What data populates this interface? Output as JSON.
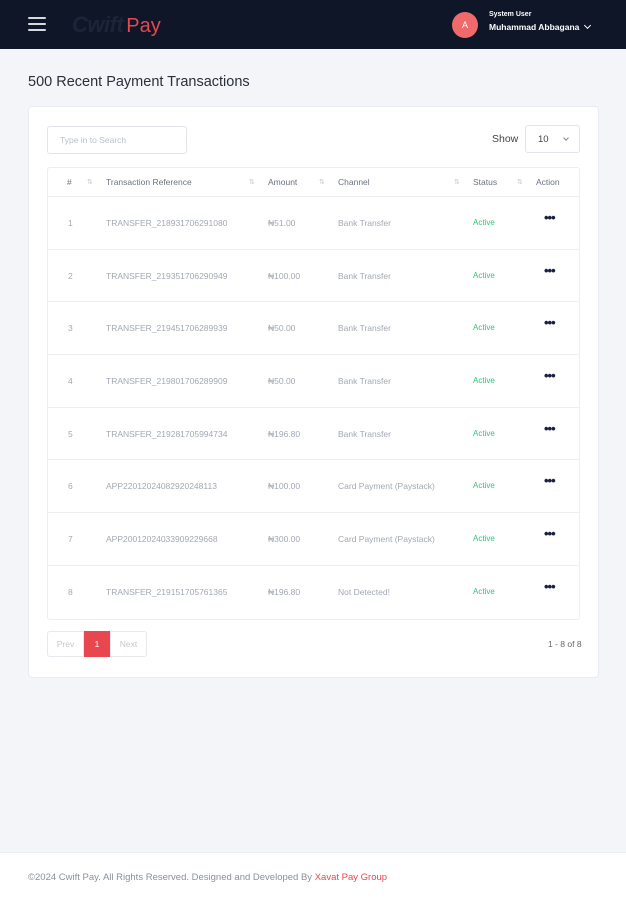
{
  "header": {
    "logo_part1": "Cwift",
    "logo_part2": "Pay",
    "avatar_initial": "A",
    "user_role": "System User",
    "user_name": "Muhammad Abbagana"
  },
  "page": {
    "title": "500 Recent Payment Transactions"
  },
  "controls": {
    "search_placeholder": "Type in to Search",
    "show_label": "Show",
    "show_value": "10"
  },
  "table": {
    "columns": [
      "#",
      "Transaction Reference",
      "Amount",
      "Channel",
      "Status",
      "Action"
    ],
    "rows": [
      {
        "num": "1",
        "ref": "TRANSFER_218931706291080",
        "amount": "₦51.00",
        "channel": "Bank Transfer",
        "status": "Active"
      },
      {
        "num": "2",
        "ref": "TRANSFER_219351706290949",
        "amount": "₦100.00",
        "channel": "Bank Transfer",
        "status": "Active"
      },
      {
        "num": "3",
        "ref": "TRANSFER_219451706289939",
        "amount": "₦50.00",
        "channel": "Bank Transfer",
        "status": "Active"
      },
      {
        "num": "4",
        "ref": "TRANSFER_219801706289909",
        "amount": "₦50.00",
        "channel": "Bank Transfer",
        "status": "Active"
      },
      {
        "num": "5",
        "ref": "TRANSFER_219281705994734",
        "amount": "₦196.80",
        "channel": "Bank Transfer",
        "status": "Active"
      },
      {
        "num": "6",
        "ref": "APP22012024082920248113",
        "amount": "₦100.00",
        "channel": "Card Payment (Paystack)",
        "status": "Active"
      },
      {
        "num": "7",
        "ref": "APP20012024033909229668",
        "amount": "₦300.00",
        "channel": "Card Payment (Paystack)",
        "status": "Active"
      },
      {
        "num": "8",
        "ref": "TRANSFER_219151705761365",
        "amount": "₦196.80",
        "channel": "Not Detected!",
        "status": "Active"
      }
    ]
  },
  "pagination": {
    "prev": "Prev",
    "current": "1",
    "next": "Next",
    "range": "1 - 8 of 8"
  },
  "footer": {
    "text": "©2024 Cwift Pay. All Rights Reserved. Designed and Developed By ",
    "link": "Xavat Pay Group"
  },
  "colors": {
    "topbar": "#0e1628",
    "accent": "#e8474f",
    "status_active": "#35c27c"
  }
}
